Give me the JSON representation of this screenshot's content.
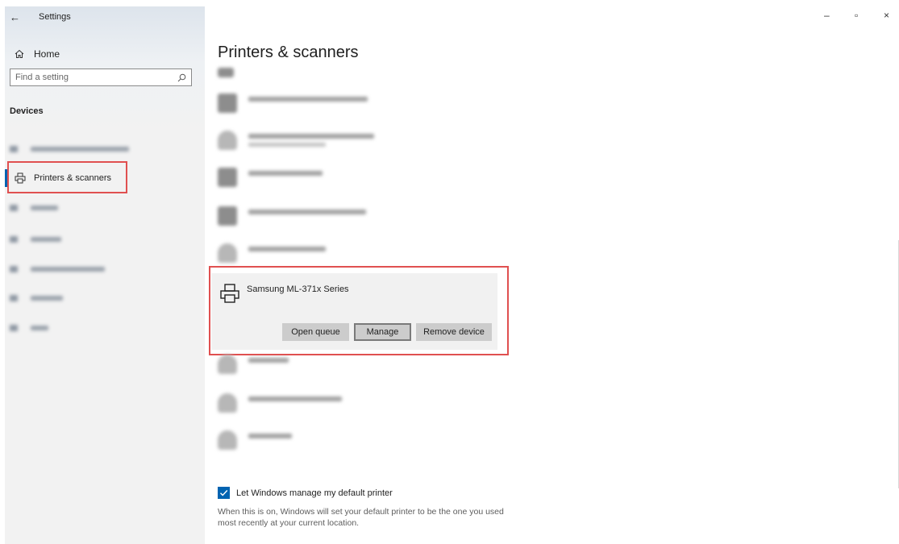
{
  "window": {
    "title": "Settings",
    "controls": {
      "minimize": "–",
      "restore": "▫",
      "close": "×"
    }
  },
  "sidebar": {
    "home_label": "Home",
    "search_placeholder": "Find a setting",
    "section_label": "Devices",
    "active_item_label": "Printers & scanners"
  },
  "main": {
    "title": "Printers & scanners",
    "selected_device": {
      "name": "Samsung ML-371x Series",
      "buttons": {
        "open_queue": "Open queue",
        "manage": "Manage",
        "remove_device": "Remove device"
      }
    },
    "default_printer": {
      "checked": true,
      "label": "Let Windows manage my default printer",
      "description": "When this is on, Windows will set your default printer to be the one you used most recently at your current location."
    }
  },
  "colors": {
    "accent": "#0063b1",
    "highlight_border": "#e05050",
    "card_background": "#f1f1f1",
    "button_background": "#cccccc"
  }
}
